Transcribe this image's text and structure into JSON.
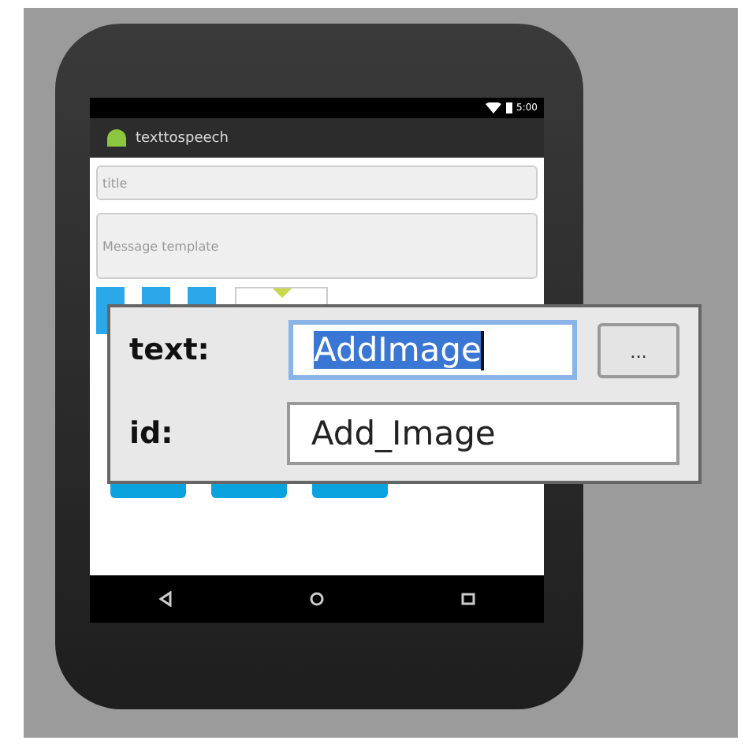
{
  "status_bar": {
    "time": "5:00"
  },
  "action_bar": {
    "title": "texttospeech"
  },
  "fields": [
    {
      "placeholder": "title",
      "kind": "single"
    },
    {
      "placeholder": "Message template",
      "kind": "multi"
    }
  ],
  "popup": {
    "rows": [
      {
        "label": "text:",
        "value": "AddImage",
        "selected": true,
        "kind": "with-button",
        "button": "..."
      },
      {
        "label": "id:",
        "value": "Add_Image",
        "selected": false,
        "kind": "plain"
      }
    ]
  }
}
